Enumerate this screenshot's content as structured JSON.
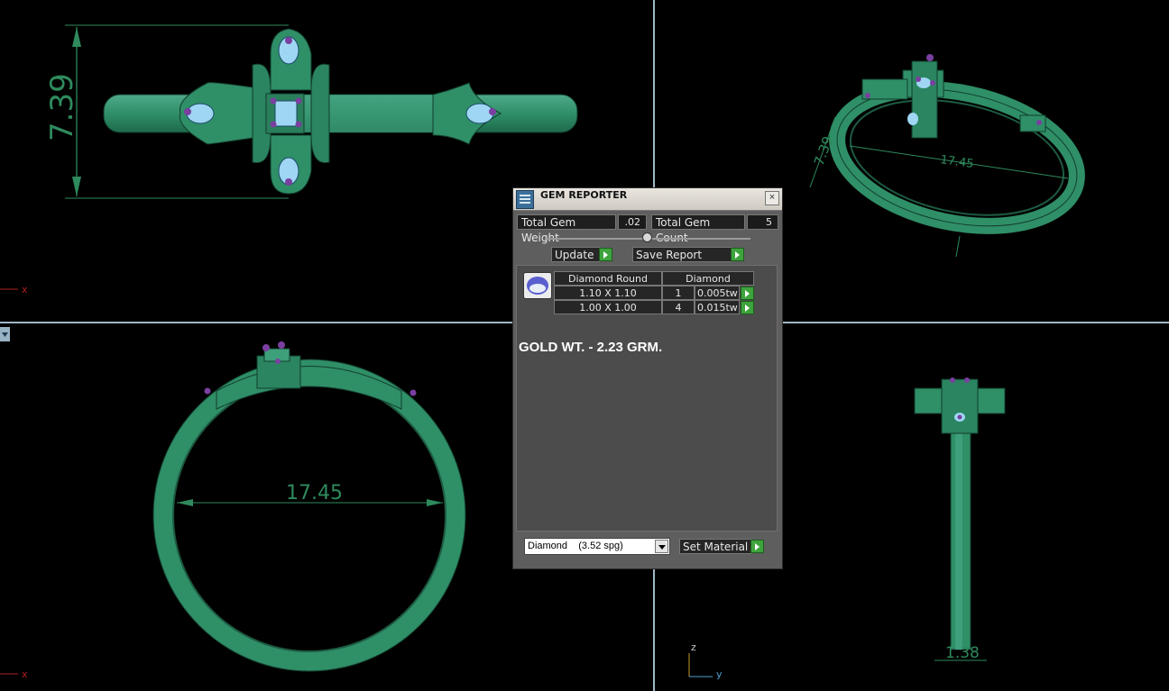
{
  "viewports": {
    "top_left": {
      "dimension_label": "7.39",
      "axis_x": "x"
    },
    "top_right": {
      "dimension_label_1": "7.39",
      "dimension_label_2": "17.45"
    },
    "bottom_left": {
      "dimension_label": "17.45",
      "axis_x": "x"
    },
    "bottom_right": {
      "dimension_label": "1.38",
      "axis_z": "z",
      "axis_y": "y"
    }
  },
  "gem_reporter": {
    "title": "GEM REPORTER",
    "total_gem_weight_label": "Total Gem Weight",
    "total_gem_weight_value": ".02",
    "total_gem_count_label": "Total Gem Count",
    "total_gem_count_value": "5",
    "update_label": "Update",
    "save_report_label": "Save Report",
    "table": {
      "headers": [
        "Diamond Round",
        "Diamond"
      ],
      "rows": [
        {
          "size": "1.10 X 1.10",
          "count": "1",
          "weight": "0.005tw"
        },
        {
          "size": "1.00 X 1.00",
          "count": "4",
          "weight": "0.015tw"
        }
      ]
    },
    "note": "GOLD WT. - 2.23 GRM.",
    "material_select": "Diamond    (3.52 spg)",
    "set_material_label": "Set Material"
  },
  "colors": {
    "ring_body": "#2f8f67",
    "ring_dark": "#1d5a41",
    "gem": "#9fd6f4",
    "prong": "#7a3fa0",
    "dimension": "#2e8a5c"
  }
}
